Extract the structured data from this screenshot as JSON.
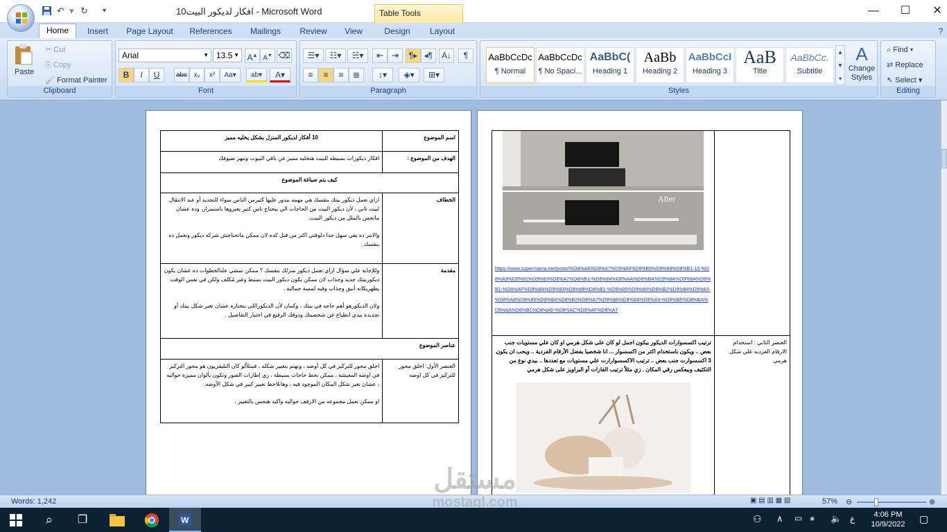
{
  "window": {
    "title": "10افكار لديكور البيت - Microsoft Word",
    "contextual_tab": "Table Tools"
  },
  "tabs": [
    "Home",
    "Insert",
    "Page Layout",
    "References",
    "Mailings",
    "Review",
    "View",
    "Design",
    "Layout"
  ],
  "ribbon": {
    "clipboard": {
      "label": "Clipboard",
      "paste": "Paste",
      "cut": "Cut",
      "copy": "Copy",
      "format_painter": "Format Painter"
    },
    "font": {
      "label": "Font",
      "family": "Arial",
      "size": "13.5"
    },
    "paragraph": {
      "label": "Paragraph"
    },
    "styles": {
      "label": "Styles",
      "items": [
        {
          "sample": "AaBbCcDc",
          "name": "¶ Normal"
        },
        {
          "sample": "AaBbCcDc",
          "name": "¶ No Spaci..."
        },
        {
          "sample": "AaBbC(",
          "name": "Heading 1"
        },
        {
          "sample": "AaBb",
          "name": "Heading 2"
        },
        {
          "sample": "AaBbCcI",
          "name": "Heading 3"
        },
        {
          "sample": "AaB",
          "name": "Title"
        },
        {
          "sample": "AaBbCc.",
          "name": "Subtitle"
        }
      ],
      "change_styles": "Change Styles"
    },
    "editing": {
      "label": "Editing",
      "find": "Find",
      "replace": "Replace",
      "select": "Select"
    }
  },
  "left_page": {
    "topic_name_label": "اسم الموضوع",
    "topic_name_value": "10 أفكار لديكور المنزل بشكل يخليه مميز",
    "goal_label": "الهدف من الموضوع :",
    "goal_value": "افكار ديكورات بسيطه للبيت هتخليه مميز عن باقي البيوت وتبهر ضيوفك",
    "how_label": "كيف يتم صياغة الموضوع",
    "hook_label": "الخطاف",
    "hook_p1": "ازاي تعمل ديكور بيتك بنفسك هي مهمه بيدور عليها كثيرمن الناس سواء للتجديد أو عند الانتقال لبيت تاني ، لأن ديكور البيت من الحاجات الي بيحتاج ناس كتير يغيروها باستمرار، وده عشان مانحس بالملل من ديكور البيت.",
    "hook_p2": "والامر ده بقي سهل جدا دلوقتي اكتر من قبل كده لان ممكن ماتحتاجش شركه ديكور وتعمل ده بنفسك .",
    "intro_label": "مقدمة",
    "intro_p1": "وللإجابة علي سؤال ازاي تعمل ديكور منزلك بنفسك ؟ ممكن تمشي علىالخطوات ده عشان يكون ديكوربيتك جديد وجذاب لان ممكن يكون ديكور البيت بسيط وغير مُكلف ولكن في نفس الوقت يظهريكانه أنيق وجذاب وفيه لمسة جمالية .",
    "intro_p2": "ولان الديكورهو أهم حاجه في بيتك ، وكمان لأن الديكوراللي بتختاره عشان تغير شكل بيتك أو تجديده بيدي انطباع عن شخصيتك وذوقك الرفيع في اختيار التفاصيل .",
    "elements_label": "عناصر الموضوع",
    "element1_label": "العنصر الأول: اخلق محور للتركيز في كل اوضه",
    "element1_p1": "اخلق محور للتركيز في كل أوضه ، ونهتم بتغيير شكله ، فمثلاًلو كان التليفزيون هو محور التركيز في اوضه المعيشة ، ممكن نحط حاجات بسيطة ، زي إطارات الصور وتكون بألوان مميزة حواليه ، عشان نغير شكل المكان الموجود فيه ، وهانلاحظ تغيير كبير في شكل الأوضه.",
    "element1_p2": "او ممكن نعمل مجموعه من الارفف حواليه واكيد هنحس بالتغيير ."
  },
  "right_page": {
    "after_label": "After",
    "link": "https://www.supermama.me/posts/%D8%A8%D8%A7%D9%84%D8%B5%D9%88%D8%B1-10-%D8%A3%D9%81%D9%83%D8%A7%D8%B1-%D9%84%D8%AA%D8%BA%D9%8A%D9%8A%D8%B1-%D8%AF%D9%8A%D9%83%D9%88%D8%B1-%D9%85%D9%86%D8%B2%D9%84%D9%83-%D8%A8%D9%85%D9%8A%D8%B2%D8%A7%D9%86%D9%8A%D8%A9-%D8%B5%D8%BA%D9%8A%D8%B1%D8%A9-%D8%AC%D8%AF%D8%A7",
    "element2_label": "العنصر الثاني : استخدام الارقام الفرديه علي شكل هرمي",
    "element2_p": "ترتيب اكسسوارات الديكور بيكون اجمل لو كان على شكل هرمي او كان علي مستويات جنب بعض .. ويكون باستخدام اكتر من اكسسوار ... انا شخصيا بفضل الأرقام الفردية .. ويحب ان يكون 3 اكسسوارت جنب بعض .. ترتيب الاكسسوارارت علي مستويات مع تعددها .. بيدي نوع من التكثيف وبيعكس رقي المكان . زي مثلاً ترتيب الفازات أو البراويز على شكل هرمي"
  },
  "status_bar": {
    "words": "Words: 1,242",
    "zoom": "57%"
  },
  "taskbar": {
    "time": "4:06 PM",
    "date": "10/9/2022",
    "lang": "ع"
  },
  "watermark": {
    "arabic": "مستقل",
    "latin": "mostaql.com"
  }
}
